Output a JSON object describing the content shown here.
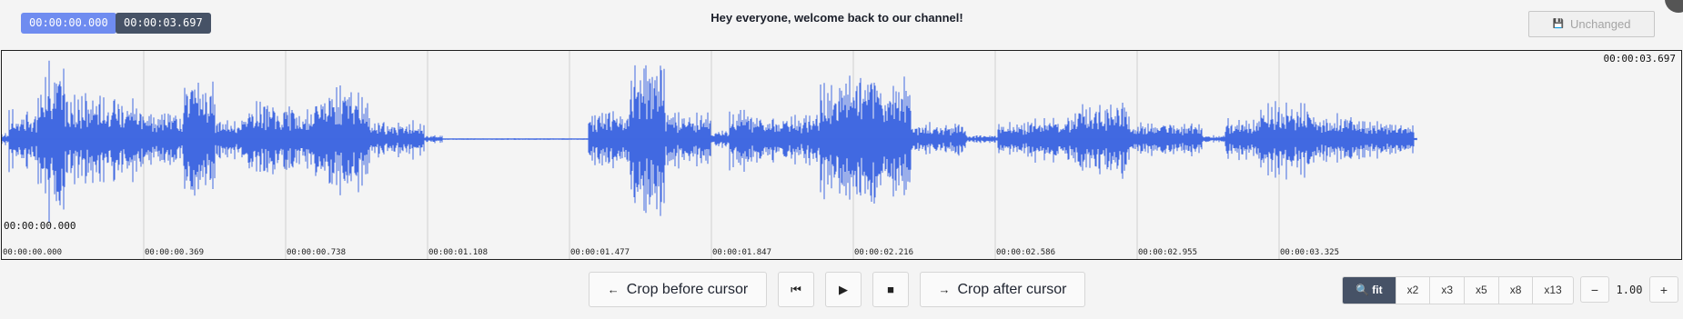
{
  "header": {
    "selection_start": "00:00:00.000",
    "selection_end": "00:00:03.697",
    "transcript": "Hey everyone, welcome back to our channel!",
    "save_label": "Unchanged",
    "save_icon": "floppy-disk-icon"
  },
  "waveform": {
    "color": "#4169e1",
    "duration_seconds": 3.697,
    "cursor_time": "00:00:00.000",
    "end_time": "00:00:03.697",
    "tick_labels": [
      "00:00:00.000",
      "00:00:00.369",
      "00:00:00.738",
      "00:00:01.108",
      "00:00:01.477",
      "00:00:01.847",
      "00:00:02.216",
      "00:00:02.586",
      "00:00:02.955",
      "00:00:03.325"
    ]
  },
  "controls": {
    "crop_before_label": "Crop before cursor",
    "crop_after_label": "Crop after cursor",
    "crop_before_icon": "arrow-left-icon",
    "crop_after_icon": "arrow-right-icon",
    "skip_start_icon": "skip-to-start-icon",
    "play_icon": "play-icon",
    "stop_icon": "stop-icon"
  },
  "zoom": {
    "fit_label": "fit",
    "options": [
      "x2",
      "x3",
      "x5",
      "x8",
      "x13"
    ],
    "selected": "fit"
  },
  "speed": {
    "minus_label": "−",
    "value": "1.00",
    "plus_label": "+"
  }
}
